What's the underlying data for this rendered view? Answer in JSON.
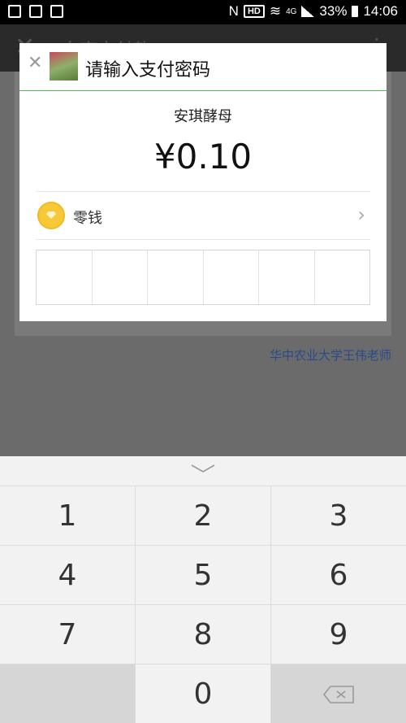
{
  "status_bar": {
    "network_label": "HD",
    "network_type": "4G",
    "battery": "33%",
    "time": "14:06"
  },
  "background_app": {
    "title": "向商户付款",
    "teacher_link": "华中农业大学王伟老师"
  },
  "dialog": {
    "title": "请输入支付密码",
    "merchant": "安琪酵母",
    "amount": "¥0.10",
    "payment_method": "零钱",
    "pin_length": 6
  },
  "keypad": {
    "keys": [
      "1",
      "2",
      "3",
      "4",
      "5",
      "6",
      "7",
      "8",
      "9",
      "0"
    ]
  },
  "colors": {
    "accent_line": "#45c04f",
    "link": "#2a4a8a",
    "coin": "#f7c936"
  }
}
